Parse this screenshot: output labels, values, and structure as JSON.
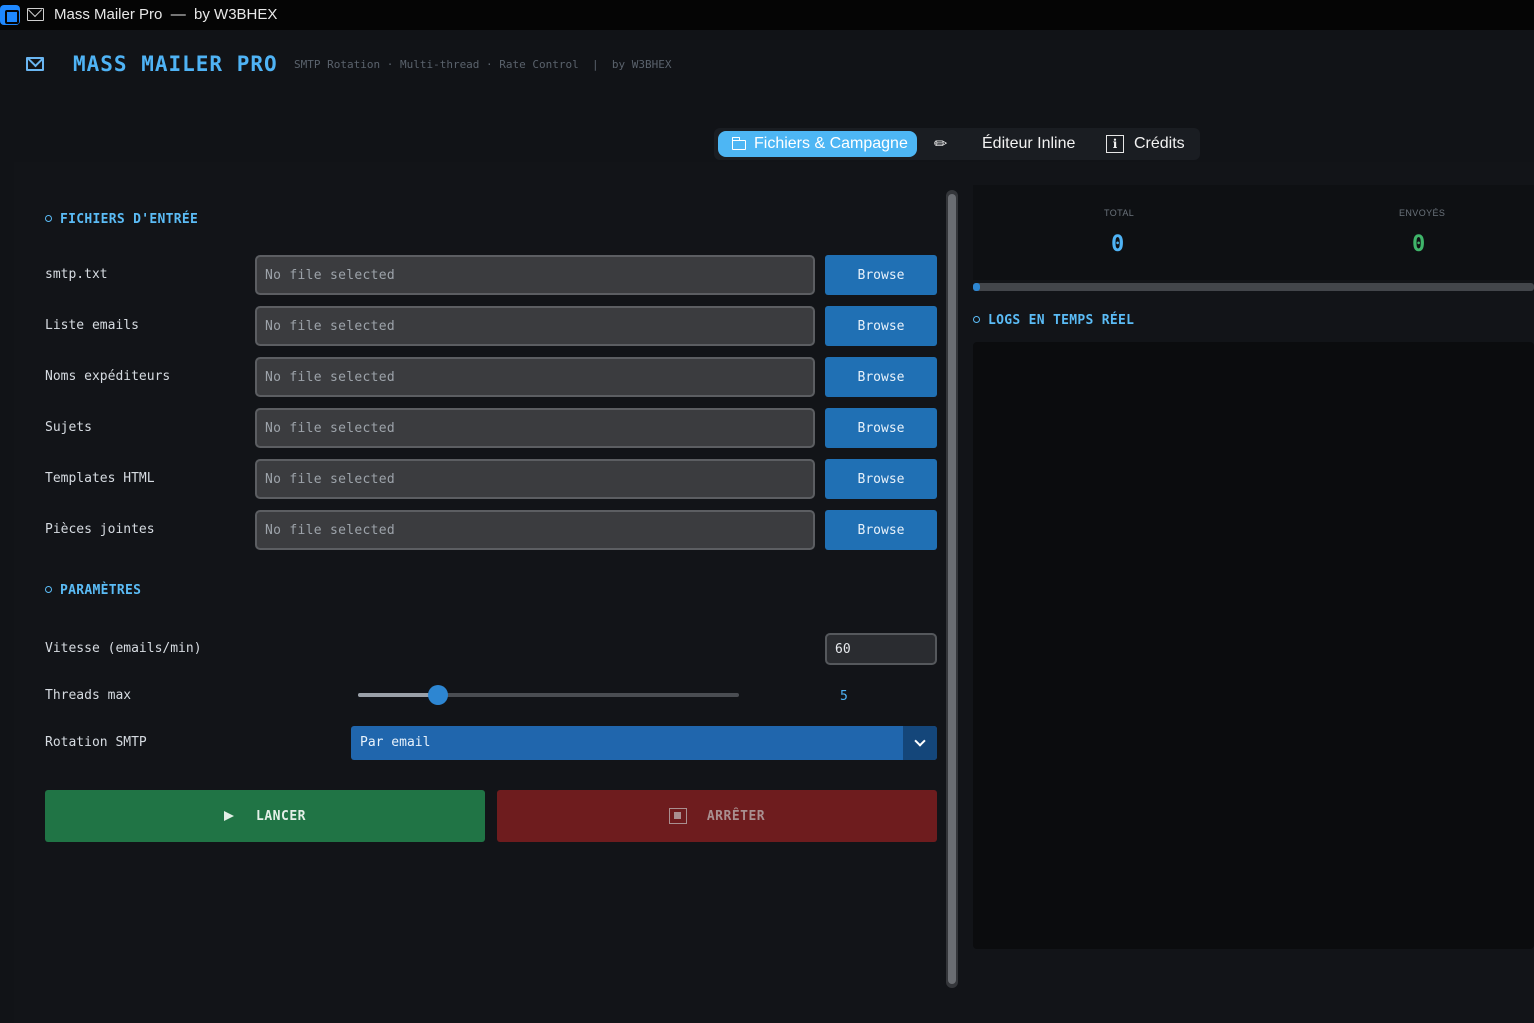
{
  "window": {
    "title": "Mass Mailer Pro  —  by W3BHEX"
  },
  "header": {
    "title": "MASS MAILER PRO",
    "subtitle": "SMTP Rotation · Multi-thread · Rate Control  |  by W3BHEX"
  },
  "tabs": [
    {
      "label": "Fichiers & Campagne",
      "active": true,
      "icon": "folder-icon"
    },
    {
      "label": "✏",
      "active": false,
      "icon": "pencil-icon"
    },
    {
      "label": "Éditeur Inline",
      "active": false
    },
    {
      "label": "Crédits",
      "active": false,
      "icon": "info-icon"
    }
  ],
  "files_section": {
    "title": "FICHIERS D'ENTRÉE",
    "browse_label": "Browse",
    "rows": [
      {
        "label": "smtp.txt",
        "value": "No file selected"
      },
      {
        "label": "Liste emails",
        "value": "No file selected"
      },
      {
        "label": "Noms expéditeurs",
        "value": "No file selected"
      },
      {
        "label": "Sujets",
        "value": "No file selected"
      },
      {
        "label": "Templates HTML",
        "value": "No file selected"
      },
      {
        "label": "Pièces jointes",
        "value": "No file selected"
      }
    ]
  },
  "params_section": {
    "title": "PARAMÈTRES",
    "speed_label": "Vitesse (emails/min)",
    "speed_value": "60",
    "threads_label": "Threads max",
    "threads_value": "5",
    "threads_level_fraction": 0.21,
    "rotation_label": "Rotation SMTP",
    "rotation_value": "Par email"
  },
  "actions": {
    "launch_label": "LANCER",
    "stop_label": "ARRÊTER"
  },
  "stats": {
    "total_label": "TOTAL",
    "total_value": "0",
    "sent_label": "ENVOYÉS",
    "sent_value": "0",
    "progress_fraction": 0.0
  },
  "logs": {
    "title": "LOGS EN TEMPS RÉEL"
  },
  "colors": {
    "accent": "#4fb3f5",
    "primary_button": "#2070b4",
    "launch": "#207445",
    "stop": "#6e1c1e",
    "sent_value": "#3fb56a"
  }
}
